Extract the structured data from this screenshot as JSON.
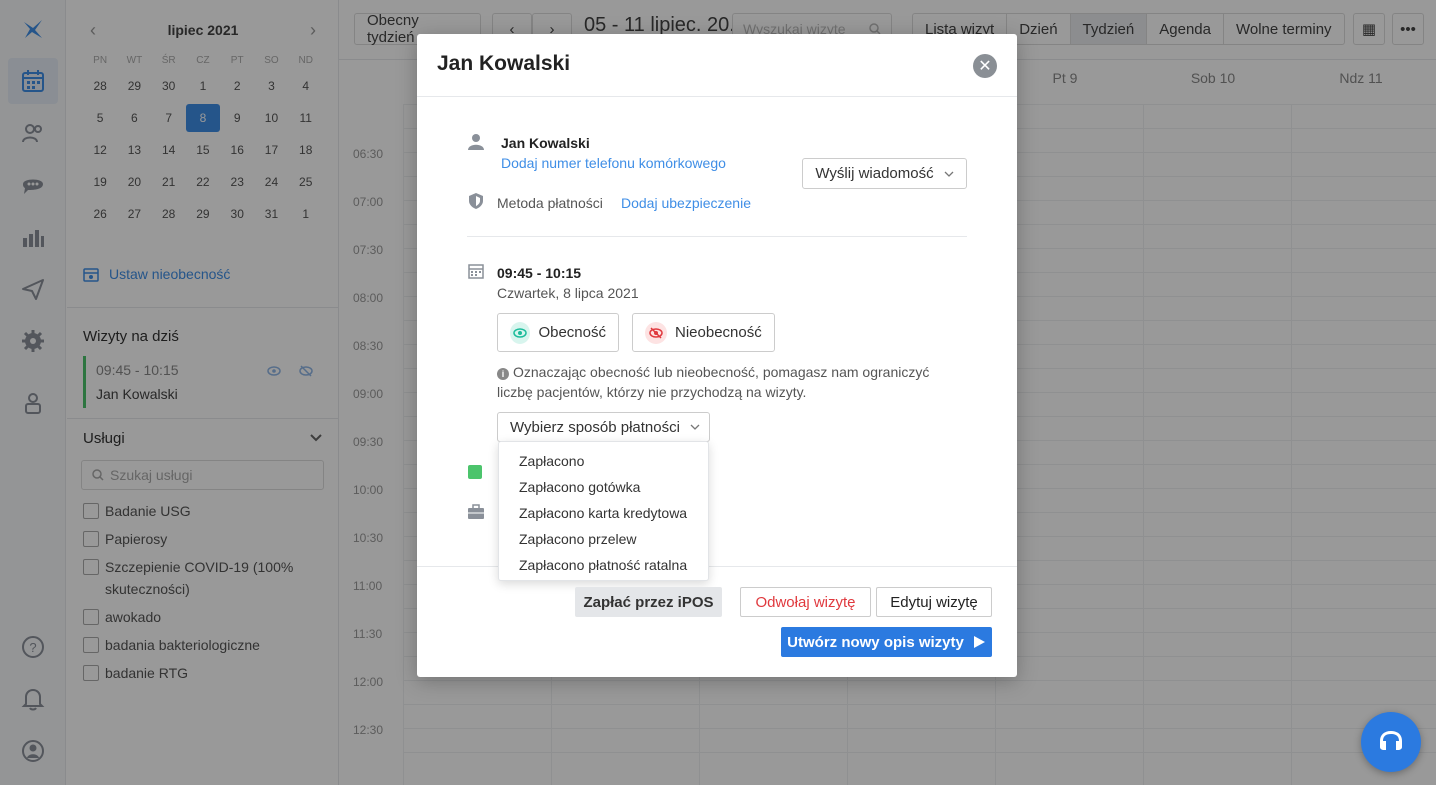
{
  "toolbar": {
    "current_week": "Obecny tydzień",
    "week_range": "05 - 11 lipiec. 20...",
    "search_placeholder": "Wyszukaj wizyte",
    "views": [
      "Lista wizyt",
      "Dzień",
      "Tydzień",
      "Agenda",
      "Wolne terminy"
    ],
    "active_view": "Tydzień"
  },
  "grid": {
    "days": [
      "Pt 9",
      "Sob 10",
      "Ndz 11"
    ],
    "times": [
      "06:30",
      "07:00",
      "07:30",
      "08:00",
      "08:30",
      "09:00",
      "09:30",
      "10:00",
      "10:30",
      "11:00",
      "11:30",
      "12:00",
      "12:30"
    ]
  },
  "mini_calendar": {
    "month": "lipiec 2021",
    "day_names": [
      "PN",
      "WT",
      "ŚR",
      "CZ",
      "PT",
      "SO",
      "ND"
    ],
    "weeks": [
      [
        "28",
        "29",
        "30",
        "1",
        "2",
        "3",
        "4"
      ],
      [
        "5",
        "6",
        "7",
        "8",
        "9",
        "10",
        "11"
      ],
      [
        "12",
        "13",
        "14",
        "15",
        "16",
        "17",
        "18"
      ],
      [
        "19",
        "20",
        "21",
        "22",
        "23",
        "24",
        "25"
      ],
      [
        "26",
        "27",
        "28",
        "29",
        "30",
        "31",
        "1"
      ]
    ],
    "selected": "8"
  },
  "sidebar": {
    "set_absence": "Ustaw nieobecność",
    "today_title": "Wizyty na dziś",
    "today_time": "09:45 - 10:15",
    "today_patient": "Jan Kowalski",
    "services_title": "Usługi",
    "services_search_placeholder": "Szukaj usługi",
    "services": [
      "Badanie USG",
      "Papierosy",
      "Szczepienie COVID-19 (100% skuteczności)",
      "awokado",
      "badania bakteriologiczne",
      "badanie RTG"
    ]
  },
  "modal": {
    "title": "Jan Kowalski",
    "patient_name": "Jan Kowalski",
    "add_phone": "Dodaj numer telefonu komórkowego",
    "send_message": "Wyślij wiadomość",
    "payment_method_label": "Metoda płatności",
    "add_insurance": "Dodaj ubezpieczenie",
    "time": "09:45 - 10:15",
    "date": "Czwartek, 8 lipca 2021",
    "attendance": "Obecność",
    "absence": "Nieobecność",
    "info": "Oznaczając obecność lub nieobecność, pomagasz nam ograniczyć liczbę pacjentów, którzy nie przychodzą na wizyty.",
    "payment_select": "Wybierz sposób płatności",
    "payment_options": [
      "Zapłacono",
      "Zapłacono gotówka",
      "Zapłacono karta kredytowa",
      "Zapłacono przelew",
      "Zapłacono płatność ratalna"
    ],
    "pay_ipos": "Zapłać przez iPOS",
    "cancel_visit": "Odwołaj wizytę",
    "edit_visit": "Edytuj wizytę",
    "new_description": "Utwórz nowy opis wizyty"
  },
  "colors": {
    "accent": "#2b7ae0",
    "link": "#3f8ee6",
    "danger": "#e0393e",
    "success": "#4cc46c"
  }
}
